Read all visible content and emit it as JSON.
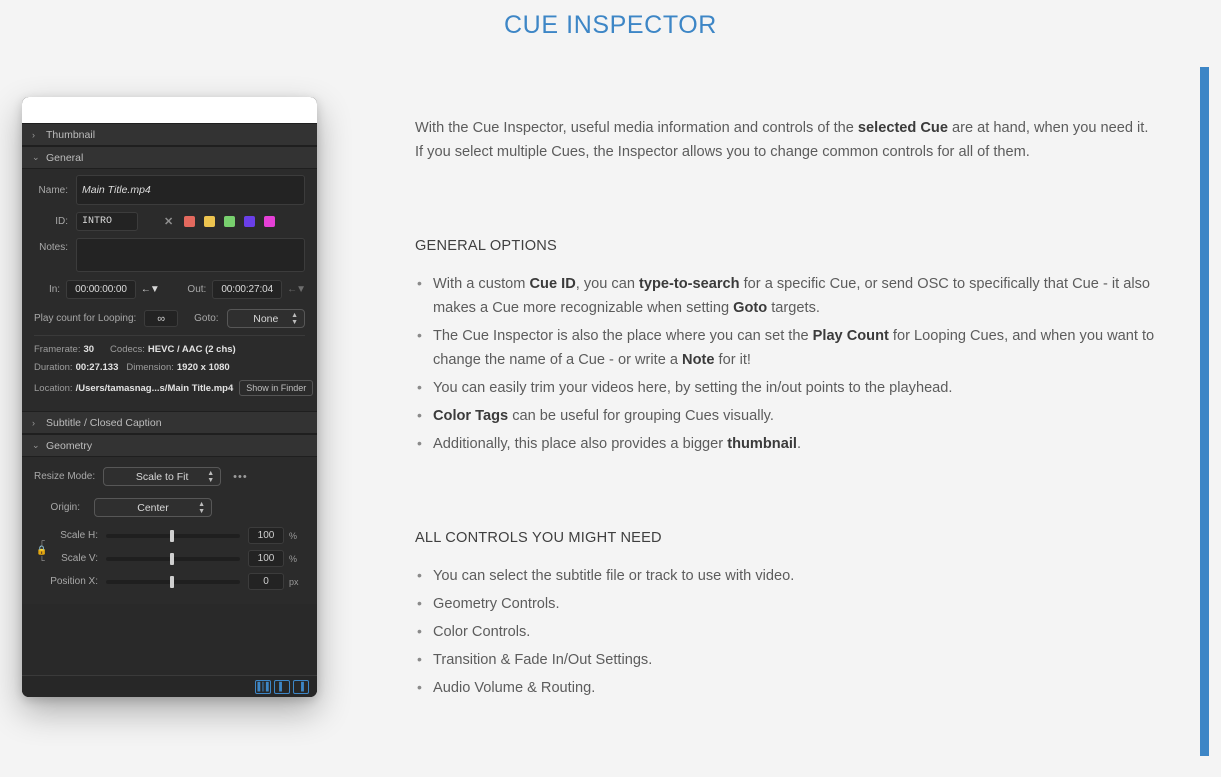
{
  "page": {
    "title": "CUE INSPECTOR",
    "accent_color": "#3d86c6",
    "background_color": "#f4f4f4"
  },
  "intro": {
    "part1": "With the Cue Inspector, useful media information and controls of the ",
    "bold1": "selected Cue",
    "part2": " are at hand, when you need it. If you select multiple Cues, the Inspector allows you to change common controls for all of them."
  },
  "sections": [
    {
      "heading": "GENERAL OPTIONS",
      "bullets": [
        {
          "a": "With a custom ",
          "b1": "Cue ID",
          "c": ", you can ",
          "b2": "type-to-search",
          "d": " for a specific Cue, or send OSC to specifically that Cue - it also makes a Cue more recognizable when setting ",
          "b3": "Goto",
          "e": " targets."
        },
        {
          "a": "The Cue Inspector is also the place where you can set the ",
          "b1": "Play Count",
          "c": " for Looping Cues, and when you want to change the name of a Cue - or write a ",
          "b2": "Note",
          "d": " for it!"
        },
        {
          "a": "You can easily trim your videos here, by setting the in/out points to the playhead."
        },
        {
          "b1": "Color Tags",
          "c": " can be useful for grouping Cues visually."
        },
        {
          "a": "Additionally, this place also provides a bigger ",
          "b1": "thumbnail",
          "c": "."
        }
      ]
    },
    {
      "heading": "ALL CONTROLS YOU MIGHT NEED",
      "bullets": [
        {
          "a": "You can select the subtitle file or track to use with video."
        },
        {
          "a": "Geometry Controls."
        },
        {
          "a": "Color Controls."
        },
        {
          "a": "Transition & Fade In/Out Settings."
        },
        {
          "a": "Audio Volume & Routing."
        }
      ]
    }
  ],
  "inspector": {
    "thumbnail_section": {
      "label": "Thumbnail",
      "disclosure": "›"
    },
    "general_section": {
      "label": "General",
      "disclosure": "⌄"
    },
    "name": {
      "label": "Name:",
      "value": "Main Title.mp4"
    },
    "id": {
      "label": "ID:",
      "value": "INTRO"
    },
    "clear_tag_icon": "✕",
    "color_tags": [
      "#e3695e",
      "#edc44f",
      "#78d06e",
      "#6a3fe8",
      "#e540d6"
    ],
    "notes": {
      "label": "Notes:",
      "value": ""
    },
    "in": {
      "label": "In:",
      "value": "00:00:00:00"
    },
    "out": {
      "label": "Out:",
      "value": "00:00:27:04"
    },
    "set_to_playhead_icon": "←▼",
    "play_count": {
      "label": "Play count for Looping:",
      "value": "∞"
    },
    "goto": {
      "label": "Goto:",
      "value": "None",
      "arrows": "⬍"
    },
    "framerate": {
      "label": "Framerate:",
      "value": "30"
    },
    "codecs": {
      "label": "Codecs:",
      "value": "HEVC / AAC (2 chs)"
    },
    "duration": {
      "label": "Duration:",
      "value": "00:27.133"
    },
    "dimension": {
      "label": "Dimension:",
      "value": "1920 x 1080"
    },
    "location": {
      "label": "Location:",
      "value": "/Users/tamasnag...s/Main Title.mp4"
    },
    "show_in_finder": "Show in Finder",
    "subtitle_section": {
      "label": "Subtitle / Closed Caption",
      "disclosure": "›"
    },
    "geometry_section": {
      "label": "Geometry",
      "disclosure": "⌄"
    },
    "resize_mode": {
      "label": "Resize Mode:",
      "value": "Scale to Fit",
      "arrows": "⬍"
    },
    "more_options_icon": "•••",
    "origin": {
      "label": "Origin:",
      "value": "Center",
      "arrows": "⬍"
    },
    "lock_icon": "🔒",
    "scale_h": {
      "label": "Scale H:",
      "value": "100",
      "unit": "%"
    },
    "scale_v": {
      "label": "Scale V:",
      "value": "100",
      "unit": "%"
    },
    "position_x": {
      "label": "Position X:",
      "value": "0",
      "unit": "px"
    },
    "footer_buttons": [
      "▌▌▌",
      "▌",
      "▌"
    ]
  }
}
